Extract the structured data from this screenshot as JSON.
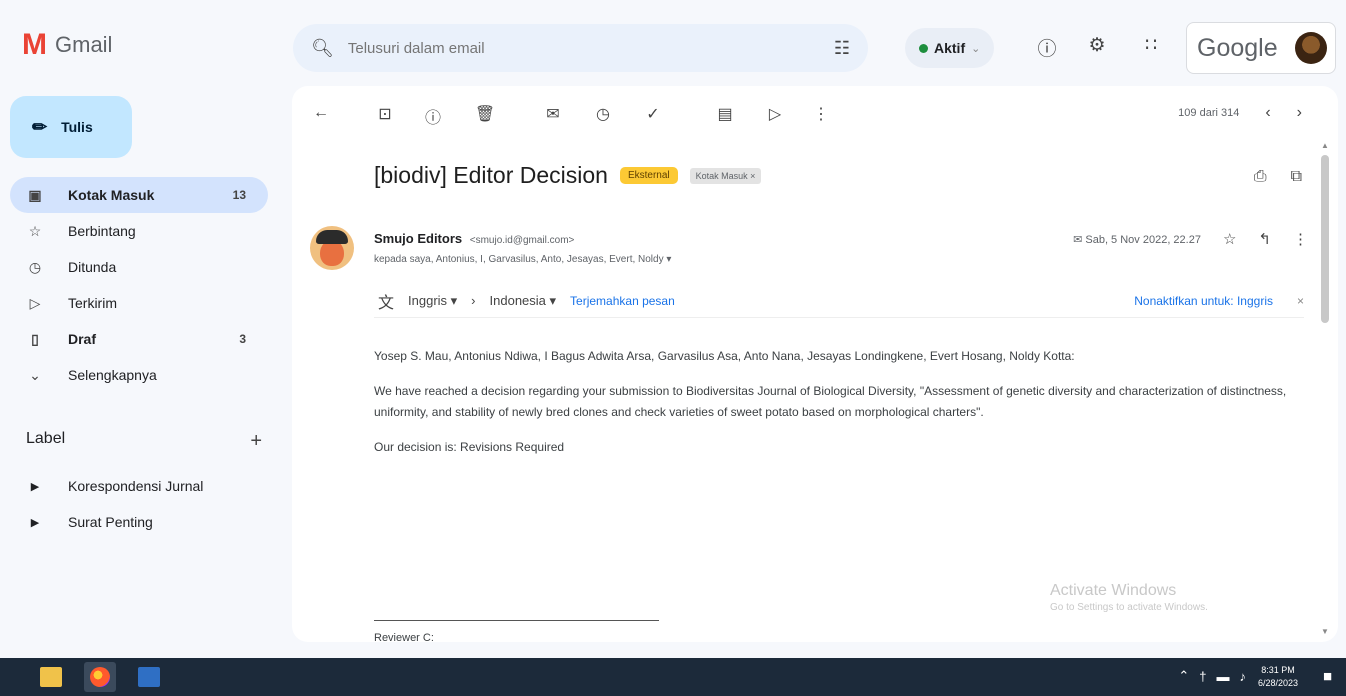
{
  "app": {
    "name": "Gmail"
  },
  "search": {
    "placeholder": "Telusuri dalam email"
  },
  "status": {
    "label": "Aktif"
  },
  "account": {
    "google_label": "Google"
  },
  "compose": {
    "label": "Tulis"
  },
  "nav": {
    "items": [
      {
        "label": "Kotak Masuk",
        "count": "13",
        "icon": "inbox-icon",
        "active": true
      },
      {
        "label": "Berbintang",
        "count": "",
        "icon": "star-icon"
      },
      {
        "label": "Ditunda",
        "count": "",
        "icon": "clock-icon"
      },
      {
        "label": "Terkirim",
        "count": "",
        "icon": "send-icon"
      },
      {
        "label": "Draf",
        "count": "3",
        "icon": "draft-icon"
      },
      {
        "label": "Selengkapnya",
        "count": "",
        "icon": "chevron-down-icon"
      }
    ]
  },
  "labels": {
    "heading": "Label",
    "items": [
      {
        "label": "Korespondensi Jurnal",
        "icon": "label-icon"
      },
      {
        "label": "Surat Penting",
        "icon": "label-icon"
      }
    ]
  },
  "pager": {
    "text": "109 dari 314"
  },
  "email": {
    "subject": "[biodiv] Editor Decision",
    "badge_external": "Eksternal",
    "badge_inbox": "Kotak Masuk ×",
    "sender_name": "Smujo Editors",
    "sender_email": "<smujo.id@gmail.com>",
    "recipients": "kepada saya, Antonius, I, Garvasilus, Anto, Jesayas, Evert, Noldy ▾",
    "date": "Sab, 5 Nov 2022, 22.27",
    "translate": {
      "from": "Inggris ▾",
      "to": "Indonesia ▾",
      "action": "Terjemahkan pesan",
      "disable": "Nonaktifkan untuk: Inggris"
    },
    "body": {
      "greeting": "Yosep S. Mau, Antonius Ndiwa, I Bagus Adwita Arsa, Garvasilus Asa, Anto Nana, Jesayas Londingkene, Evert Hosang, Noldy Kotta:",
      "paragraph1": "We have reached a decision regarding your submission to Biodiversitas Journal of Biological Diversity, \"Assessment of genetic diversity and characterization of distinctness, uniformity, and stability of newly bred clones and check varieties of sweet potato based on morphological charters\".",
      "paragraph2": "Our decision is: Revisions Required",
      "reviewer": "Reviewer C:"
    }
  },
  "watermark": {
    "line1": "Activate Windows",
    "line2": "Go to Settings to activate Windows."
  },
  "taskbar": {
    "time": "8:31 PM",
    "date": "6/28/2023"
  }
}
